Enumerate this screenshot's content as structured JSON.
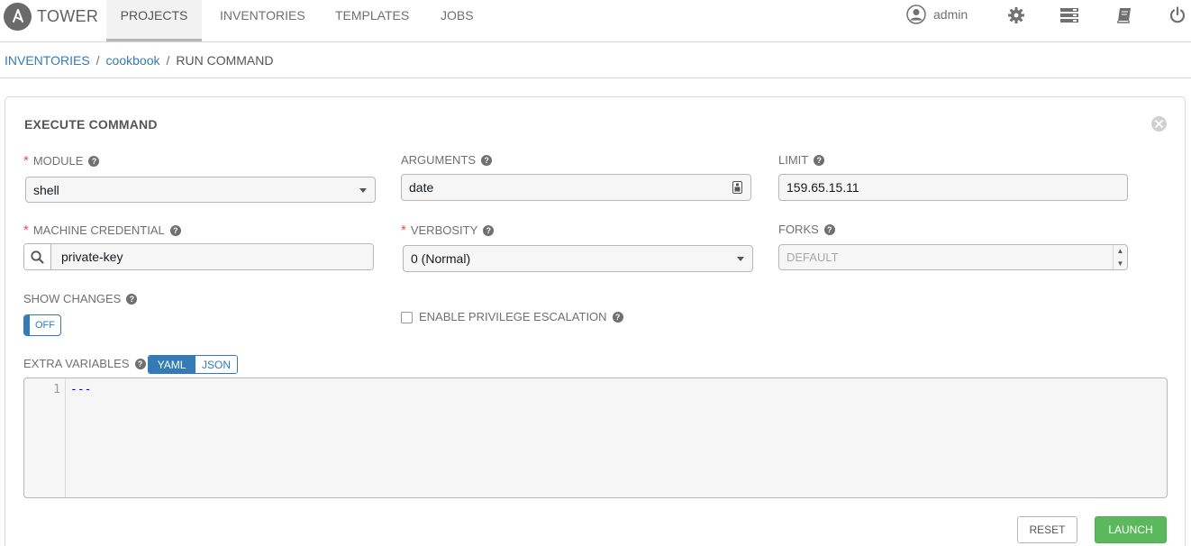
{
  "brand": {
    "name": "TOWER"
  },
  "nav": {
    "tabs": [
      {
        "label": "PROJECTS",
        "active": true
      },
      {
        "label": "INVENTORIES",
        "active": false
      },
      {
        "label": "TEMPLATES",
        "active": false
      },
      {
        "label": "JOBS",
        "active": false
      }
    ],
    "user": "admin",
    "icons": [
      "user-icon",
      "gear-icon",
      "server-icon",
      "book-icon",
      "power-icon"
    ]
  },
  "breadcrumb": {
    "items": [
      "INVENTORIES",
      "cookbook"
    ],
    "current": "RUN COMMAND"
  },
  "panel": {
    "title": "EXECUTE COMMAND",
    "module": {
      "label": "MODULE",
      "value": "shell",
      "required": true
    },
    "arguments": {
      "label": "ARGUMENTS",
      "value": "date"
    },
    "limit": {
      "label": "LIMIT",
      "value": "159.65.15.11"
    },
    "credential": {
      "label": "MACHINE CREDENTIAL",
      "value": "private-key",
      "required": true
    },
    "verbosity": {
      "label": "VERBOSITY",
      "value": "0 (Normal)",
      "required": true
    },
    "forks": {
      "label": "FORKS",
      "placeholder": "DEFAULT"
    },
    "show_changes": {
      "label": "SHOW CHANGES",
      "state": "OFF"
    },
    "privilege": {
      "label": "ENABLE PRIVILEGE ESCALATION",
      "checked": false
    },
    "extra_vars": {
      "label": "EXTRA VARIABLES",
      "modes": [
        "YAML",
        "JSON"
      ],
      "active_mode": "YAML",
      "line_number": "1",
      "content": "---"
    },
    "buttons": {
      "reset": "RESET",
      "launch": "LAUNCH"
    }
  },
  "colors": {
    "link": "#337ab7",
    "required": "#d9534f",
    "launch": "#5cb85c"
  }
}
